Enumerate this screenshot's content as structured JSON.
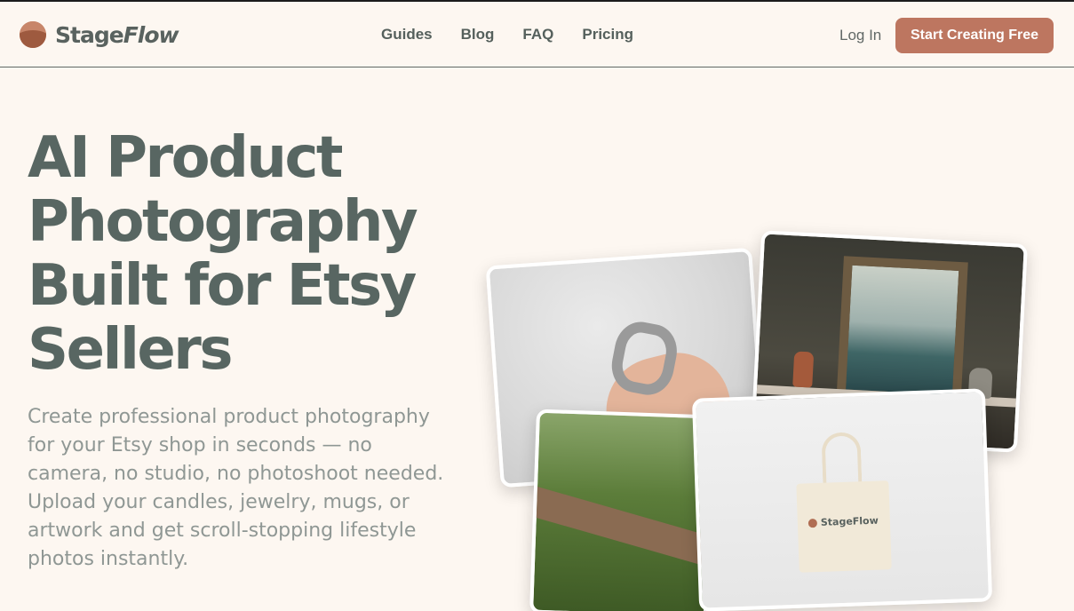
{
  "header": {
    "logo": {
      "name_part1": "Stage",
      "name_part2": "Flow"
    },
    "nav": [
      {
        "label": "Guides"
      },
      {
        "label": "Blog"
      },
      {
        "label": "FAQ"
      },
      {
        "label": "Pricing"
      }
    ],
    "login_label": "Log In",
    "cta_label": "Start Creating Free"
  },
  "hero": {
    "title": "AI Product Photography Built for Etsy Sellers",
    "subtitle": "Create professional product photography for your Etsy shop in seconds — no camera, no studio, no photoshoot needed. Upload your candles, jewelry, mugs, or artwork and get scroll-stopping lifestyle photos instantly.",
    "tote_brand": "StageFlow"
  },
  "colors": {
    "background": "#fdf7f1",
    "brand": "#bd7660",
    "heading": "#586662",
    "body_text": "#8f9794"
  }
}
